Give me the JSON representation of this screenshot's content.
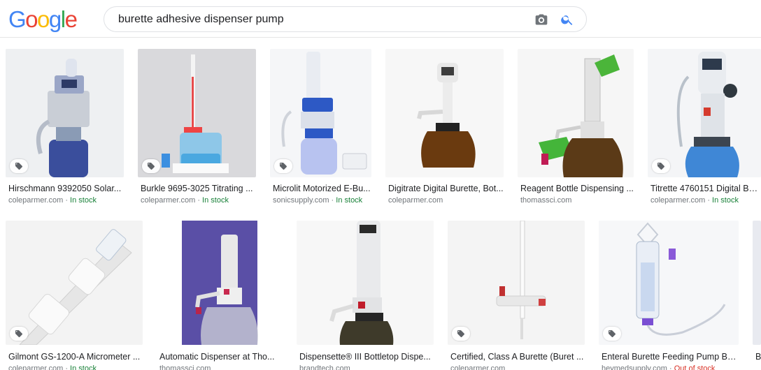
{
  "header": {
    "logo_letters": [
      "G",
      "o",
      "o",
      "g",
      "l",
      "e"
    ],
    "logo_colors": [
      "#4285F4",
      "#EA4335",
      "#FBBC05",
      "#4285F4",
      "#34A853",
      "#EA4335"
    ],
    "search_value": "burette adhesive dispenser pump",
    "camera_icon": "camera-icon",
    "search_icon": "magnifier-icon",
    "accent_color": "#4285F4"
  },
  "results": [
    {
      "title": "Hirschmann 9392050 Solar...",
      "source": "coleparmer.com",
      "stock": "In stock",
      "stock_status": "in"
    },
    {
      "title": "Burkle 9695-3025 Titrating ...",
      "source": "coleparmer.com",
      "stock": "In stock",
      "stock_status": "in"
    },
    {
      "title": "Microlit Motorized E-Bu...",
      "source": "sonicsupply.com",
      "stock": "In stock",
      "stock_status": "in"
    },
    {
      "title": "Digitrate Digital Burette, Bot...",
      "source": "coleparmer.com",
      "stock": "",
      "stock_status": "none"
    },
    {
      "title": "Reagent Bottle Dispensing ...",
      "source": "thomassci.com",
      "stock": "",
      "stock_status": "none"
    },
    {
      "title": "Titrette 4760151 Digital Bot...",
      "source": "coleparmer.com",
      "stock": "In stock",
      "stock_status": "in"
    },
    {
      "title": "Gilmont GS-1200-A Micrometer ...",
      "source": "coleparmer.com",
      "stock": "In stock",
      "stock_status": "in"
    },
    {
      "title": "Automatic Dispenser at Tho...",
      "source": "thomassci.com",
      "stock": "",
      "stock_status": "none"
    },
    {
      "title": "Dispensette® III Bottletop Dispe...",
      "source": "brandtech.com",
      "stock": "",
      "stock_status": "none"
    },
    {
      "title": "Certified, Class A Burette (Buret ...",
      "source": "coleparmer.com",
      "stock": "",
      "stock_status": "none"
    },
    {
      "title": "Enteral Burette Feeding Pump Ba...",
      "source": "heymedsupply.com",
      "stock": "Out of stock",
      "stock_status": "out"
    },
    {
      "title": "B",
      "source": "",
      "stock": "",
      "stock_status": "none"
    }
  ]
}
